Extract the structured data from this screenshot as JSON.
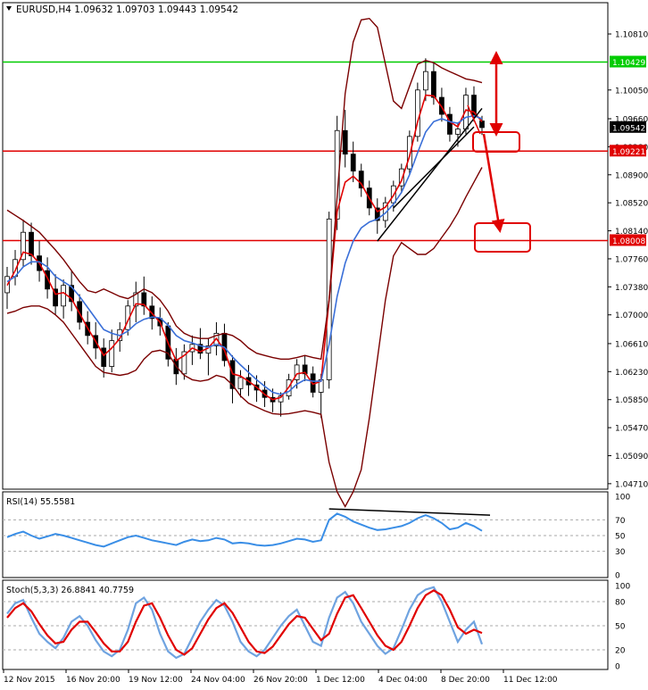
{
  "chart_data": {
    "type": "candlestick",
    "instrument": "EURUSD,H4",
    "ohlc_text": "1.09632 1.09703 1.09443 1.09542",
    "title": "EURUSD,H4  1.09632 1.09703 1.09443 1.09542",
    "price_ticks": [
      "1.10810",
      "1.10050",
      "1.09660",
      "1.09280",
      "1.08900",
      "1.08520",
      "1.08140",
      "1.07760",
      "1.07380",
      "1.07000",
      "1.06610",
      "1.06230",
      "1.05850",
      "1.05470",
      "1.05090",
      "1.04710"
    ],
    "price_range": [
      1.0466,
      1.1121
    ],
    "current_price": "1.09542",
    "levels": [
      {
        "price": 1.10429,
        "label": "1.10429",
        "color": "#00cc00"
      },
      {
        "price": 1.09221,
        "label": "1.09221",
        "color": "#e00000"
      },
      {
        "price": 1.08008,
        "label": "1.08008",
        "color": "#e00000"
      }
    ],
    "x_labels": [
      "12 Nov 2015",
      "16 Nov 20:00",
      "19 Nov 12:00",
      "24 Nov 04:00",
      "26 Nov 20:00",
      "1 Dec 12:00",
      "4 Dec 04:00",
      "8 Dec 20:00",
      "11 Dec 12:00"
    ],
    "candles": [
      [
        1.073,
        1.0765,
        1.0708,
        1.0752
      ],
      [
        1.0752,
        1.0788,
        1.074,
        1.0775
      ],
      [
        1.0775,
        1.0829,
        1.0765,
        1.0812
      ],
      [
        1.0812,
        1.0825,
        1.0768,
        1.078
      ],
      [
        1.078,
        1.08,
        1.0745,
        1.076
      ],
      [
        1.076,
        1.0778,
        1.0722,
        1.0735
      ],
      [
        1.0735,
        1.0755,
        1.07,
        1.0712
      ],
      [
        1.0712,
        1.0748,
        1.0695,
        1.074
      ],
      [
        1.074,
        1.076,
        1.0705,
        1.0718
      ],
      [
        1.0718,
        1.0728,
        1.068,
        1.069
      ],
      [
        1.069,
        1.0705,
        1.066,
        1.0672
      ],
      [
        1.0672,
        1.069,
        1.064,
        1.0655
      ],
      [
        1.0655,
        1.0668,
        1.0615,
        1.063
      ],
      [
        1.063,
        1.068,
        1.0622,
        1.0665
      ],
      [
        1.0665,
        1.069,
        1.065,
        1.068
      ],
      [
        1.068,
        1.072,
        1.0672,
        1.0712
      ],
      [
        1.0712,
        1.0745,
        1.069,
        1.073
      ],
      [
        1.073,
        1.0752,
        1.07,
        1.0712
      ],
      [
        1.0712,
        1.0725,
        1.068,
        1.0695
      ],
      [
        1.0695,
        1.071,
        1.0672,
        1.0685
      ],
      [
        1.0685,
        1.069,
        1.063,
        1.064
      ],
      [
        1.064,
        1.0655,
        1.0605,
        1.062
      ],
      [
        1.062,
        1.066,
        1.0612,
        1.065
      ],
      [
        1.065,
        1.0672,
        1.0632,
        1.066
      ],
      [
        1.066,
        1.0682,
        1.064,
        1.0648
      ],
      [
        1.0648,
        1.0668,
        1.0618,
        1.0658
      ],
      [
        1.0658,
        1.069,
        1.0645,
        1.0675
      ],
      [
        1.0675,
        1.0688,
        1.063,
        1.0638
      ],
      [
        1.0638,
        1.0645,
        1.058,
        1.06
      ],
      [
        1.06,
        1.0625,
        1.0588,
        1.0615
      ],
      [
        1.0615,
        1.0632,
        1.059,
        1.0605
      ],
      [
        1.0605,
        1.0618,
        1.0582,
        1.0598
      ],
      [
        1.0598,
        1.061,
        1.0575,
        1.0588
      ],
      [
        1.0588,
        1.06,
        1.0568,
        1.0582
      ],
      [
        1.0582,
        1.0595,
        1.0562,
        1.059
      ],
      [
        1.059,
        1.062,
        1.0585,
        1.0612
      ],
      [
        1.0612,
        1.064,
        1.06,
        1.0632
      ],
      [
        1.0632,
        1.0645,
        1.061,
        1.062
      ],
      [
        1.062,
        1.063,
        1.0588,
        1.0595
      ],
      [
        1.0595,
        1.062,
        1.056,
        1.0612
      ],
      [
        1.0612,
        1.084,
        1.06,
        1.083
      ],
      [
        1.083,
        1.097,
        1.0815,
        1.095
      ],
      [
        1.095,
        1.0978,
        1.09,
        1.0918
      ],
      [
        1.0918,
        1.0935,
        1.088,
        1.0895
      ],
      [
        1.0895,
        1.0905,
        1.086,
        1.0872
      ],
      [
        1.0872,
        1.0882,
        1.0835,
        1.0845
      ],
      [
        1.0845,
        1.0858,
        1.081,
        1.0828
      ],
      [
        1.0828,
        1.086,
        1.0818,
        1.0852
      ],
      [
        1.0852,
        1.0882,
        1.084,
        1.0875
      ],
      [
        1.0875,
        1.0905,
        1.0865,
        1.0898
      ],
      [
        1.0898,
        1.095,
        1.089,
        1.0942
      ],
      [
        1.0942,
        1.1015,
        1.0935,
        1.1005
      ],
      [
        1.1005,
        1.1048,
        1.099,
        1.103
      ],
      [
        1.103,
        1.1042,
        1.0985,
        1.0995
      ],
      [
        1.0995,
        1.1008,
        1.0962,
        1.0972
      ],
      [
        1.0972,
        1.0982,
        1.0935,
        1.0945
      ],
      [
        1.0945,
        1.096,
        1.0928,
        1.0952
      ],
      [
        1.0952,
        1.1008,
        1.0945,
        1.0998
      ],
      [
        1.0998,
        1.101,
        1.0962,
        1.097
      ],
      [
        1.0963,
        1.097,
        1.0944,
        1.0954
      ]
    ],
    "series": [
      {
        "name": "",
        "color": "#e00000",
        "values": [
          1.074,
          1.076,
          1.0785,
          1.0782,
          1.077,
          1.075,
          1.0728,
          1.073,
          1.0722,
          1.0702,
          1.0682,
          1.0664,
          1.0645,
          1.0655,
          1.0668,
          1.0692,
          1.0715,
          1.0714,
          1.0702,
          1.069,
          1.0662,
          1.0638,
          1.0645,
          1.0655,
          1.065,
          1.0655,
          1.0668,
          1.0652,
          1.062,
          1.0617,
          1.061,
          1.0602,
          1.0592,
          1.0585,
          1.0588,
          1.0602,
          1.062,
          1.0622,
          1.0606,
          1.061,
          1.072,
          1.084,
          1.088,
          1.0888,
          1.0878,
          1.0858,
          1.084,
          1.0846,
          1.0862,
          1.0882,
          1.0915,
          1.0962,
          1.0998,
          1.0997,
          1.0982,
          1.0962,
          1.0955,
          1.0978,
          1.0975,
          1.0962
        ]
      },
      {
        "name": "",
        "color": "#3a6fd8",
        "values": [
          1.0745,
          1.0752,
          1.0765,
          1.0772,
          1.0772,
          1.0765,
          1.0752,
          1.0745,
          1.0738,
          1.0725,
          1.071,
          1.0695,
          1.068,
          1.0675,
          1.0672,
          1.0678,
          1.0688,
          1.0694,
          1.0697,
          1.0696,
          1.0686,
          1.0672,
          1.0665,
          1.0662,
          1.0658,
          1.0656,
          1.066,
          1.0656,
          1.0643,
          1.0632,
          1.0622,
          1.0612,
          1.0603,
          1.0595,
          1.0592,
          1.0596,
          1.0606,
          1.0612,
          1.061,
          1.061,
          1.066,
          1.0725,
          1.077,
          1.08,
          1.0818,
          1.0826,
          1.083,
          1.0838,
          1.085,
          1.0866,
          1.089,
          1.092,
          1.0948,
          1.0962,
          1.0966,
          1.0962,
          1.096,
          1.0968,
          1.097,
          1.0966
        ]
      },
      {
        "name": "",
        "color": "#7a0000",
        "values": [
          1.0842,
          1.0835,
          1.0828,
          1.082,
          1.0812,
          1.08,
          1.0788,
          1.0775,
          1.076,
          1.0745,
          1.0733,
          1.073,
          1.0735,
          1.073,
          1.0725,
          1.0722,
          1.0728,
          1.0735,
          1.073,
          1.072,
          1.0705,
          1.0685,
          1.0675,
          1.067,
          1.0668,
          1.0668,
          1.0672,
          1.0675,
          1.0672,
          1.0665,
          1.0655,
          1.0648,
          1.0645,
          1.0642,
          1.064,
          1.064,
          1.0642,
          1.0645,
          1.0642,
          1.064,
          1.072,
          1.086,
          1.1,
          1.107,
          1.11,
          1.1102,
          1.109,
          1.104,
          1.099,
          1.098,
          1.101,
          1.104,
          1.1045,
          1.1042,
          1.1035,
          1.103,
          1.1025,
          1.102,
          1.1018,
          1.1015
        ]
      },
      {
        "name": "",
        "color": "#7a0000",
        "values": [
          1.0702,
          1.0705,
          1.071,
          1.0712,
          1.0712,
          1.0708,
          1.07,
          1.069,
          1.0675,
          1.066,
          1.0645,
          1.063,
          1.0622,
          1.062,
          1.0618,
          1.062,
          1.0625,
          1.064,
          1.065,
          1.0652,
          1.0648,
          1.063,
          1.0618,
          1.0612,
          1.061,
          1.0612,
          1.0618,
          1.0615,
          1.0605,
          1.059,
          1.058,
          1.0575,
          1.057,
          1.0566,
          1.0565,
          1.0566,
          1.0568,
          1.057,
          1.0568,
          1.0565,
          1.05,
          1.046,
          1.044,
          1.046,
          1.049,
          1.056,
          1.064,
          1.072,
          1.078,
          1.0798,
          1.079,
          1.0782,
          1.0782,
          1.079,
          1.0805,
          1.082,
          1.0838,
          1.086,
          1.088,
          1.09
        ]
      }
    ],
    "trendlines": [
      {
        "from": [
          46,
          1.08
        ],
        "to": [
          59,
          1.098
        ],
        "color": "#000000"
      },
      {
        "from": [
          48,
          1.0845
        ],
        "to": [
          58,
          1.0955
        ],
        "color": "#000000"
      }
    ],
    "rsi": {
      "label": "RSI(14) 55.5581",
      "color": "#3a8ee6",
      "ticks": [
        "100",
        "70",
        "50",
        "30",
        "0"
      ],
      "values": [
        48,
        52,
        55,
        50,
        46,
        49,
        52,
        50,
        47,
        44,
        41,
        38,
        36,
        40,
        44,
        48,
        50,
        47,
        44,
        42,
        40,
        38,
        42,
        45,
        43,
        44,
        47,
        45,
        40,
        41,
        40,
        38,
        37,
        38,
        40,
        43,
        46,
        45,
        42,
        44,
        70,
        78,
        74,
        68,
        64,
        60,
        57,
        58,
        60,
        62,
        66,
        72,
        76,
        72,
        66,
        58,
        60,
        66,
        62,
        56
      ],
      "divergence_line": {
        "from": [
          40,
          84
        ],
        "to": [
          60,
          76
        ]
      }
    },
    "stoch": {
      "label": "Stoch(5,3,3) 26.8841 40.7759",
      "main_color": "#6fa3e0",
      "signal_color": "#e00000",
      "ticks": [
        "100",
        "80",
        "50",
        "20",
        "0"
      ],
      "main": [
        65,
        78,
        82,
        60,
        40,
        30,
        22,
        35,
        55,
        62,
        50,
        32,
        18,
        12,
        20,
        45,
        78,
        85,
        70,
        40,
        18,
        10,
        15,
        35,
        55,
        70,
        82,
        75,
        55,
        30,
        18,
        12,
        20,
        35,
        50,
        62,
        70,
        50,
        30,
        25,
        60,
        85,
        92,
        78,
        55,
        40,
        25,
        15,
        22,
        45,
        70,
        88,
        95,
        98,
        80,
        55,
        30,
        45,
        55,
        27
      ],
      "signal": [
        60,
        72,
        78,
        68,
        52,
        38,
        28,
        30,
        45,
        55,
        55,
        42,
        28,
        18,
        18,
        30,
        55,
        75,
        78,
        60,
        38,
        20,
        14,
        22,
        40,
        58,
        72,
        78,
        66,
        48,
        30,
        18,
        16,
        24,
        38,
        52,
        62,
        60,
        46,
        32,
        40,
        65,
        85,
        88,
        72,
        55,
        38,
        25,
        20,
        30,
        50,
        72,
        88,
        94,
        88,
        70,
        48,
        40,
        45,
        41
      ]
    }
  }
}
